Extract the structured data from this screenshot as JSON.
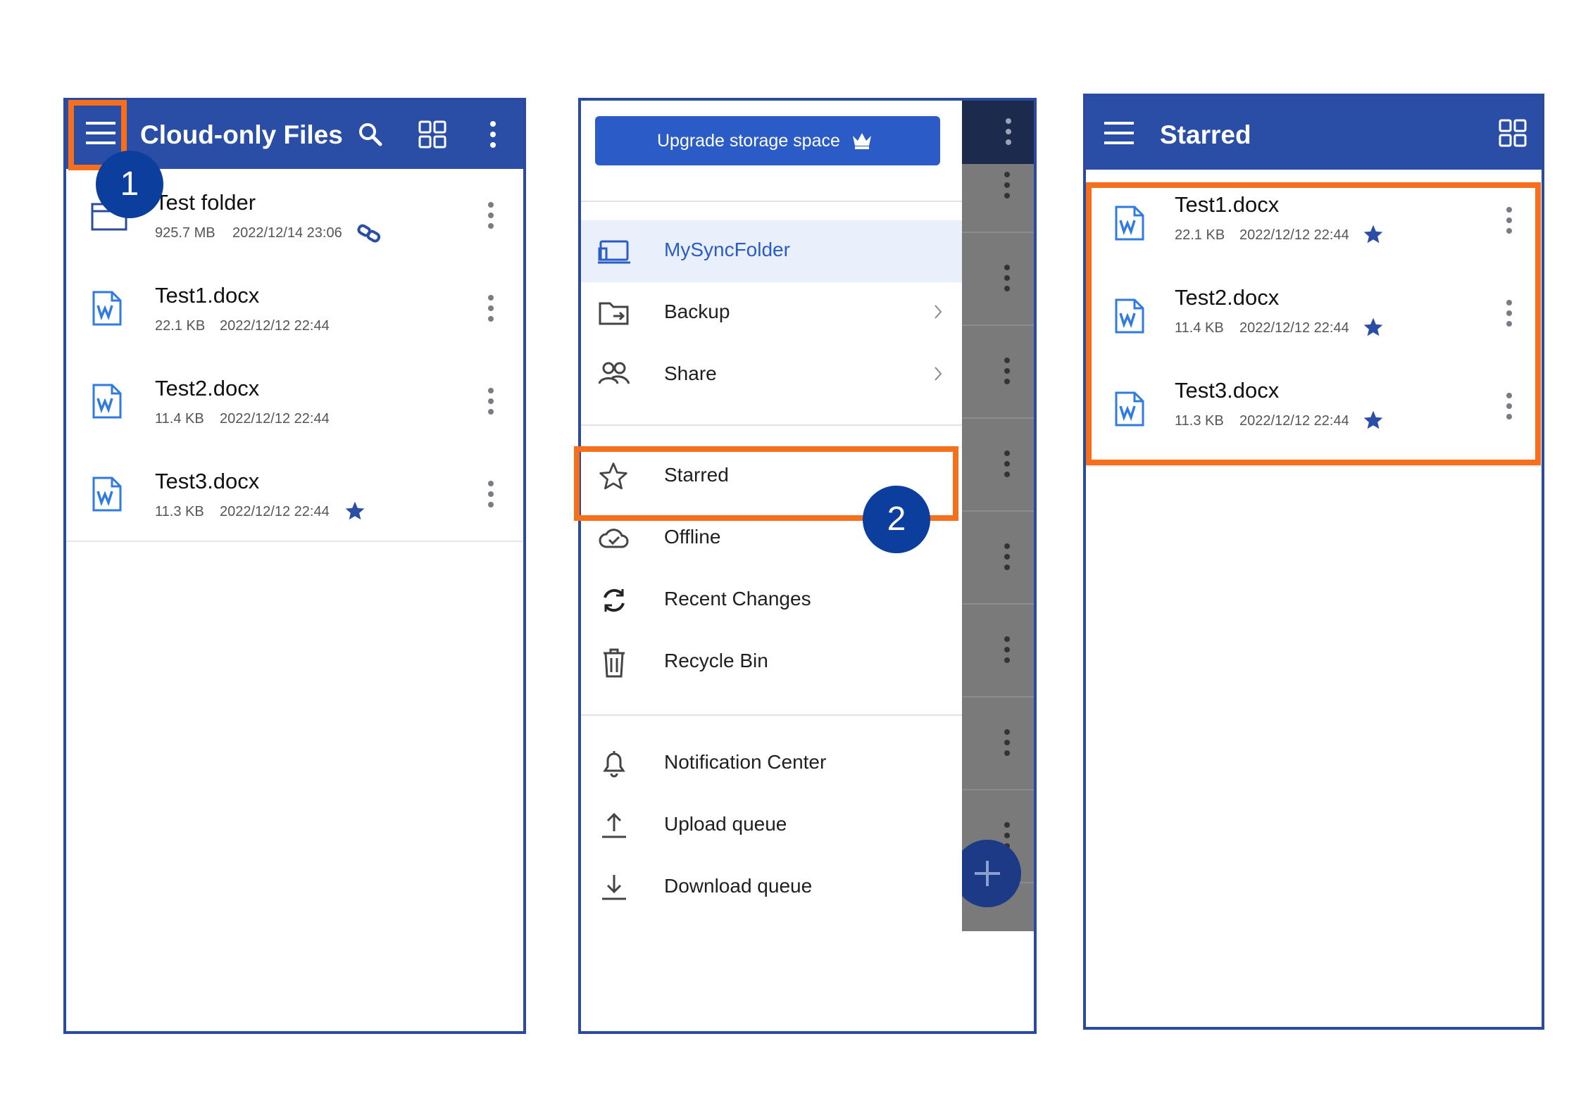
{
  "step_badges": [
    "1",
    "2"
  ],
  "panel1": {
    "title": "Cloud-only Files",
    "icons": [
      "menu-icon",
      "search-icon",
      "grid-view-icon",
      "more-vert-icon"
    ],
    "files": [
      {
        "name": "Test folder",
        "size": "925.7 MB",
        "date": "2022/12/14 23:06",
        "type": "folder",
        "linked": true,
        "starred": false
      },
      {
        "name": "Test1.docx",
        "size": "22.1 KB",
        "date": "2022/12/12 22:44",
        "type": "docx",
        "starred": false
      },
      {
        "name": "Test2.docx",
        "size": "11.4 KB",
        "date": "2022/12/12 22:44",
        "type": "docx",
        "starred": false
      },
      {
        "name": "Test3.docx",
        "size": "11.3 KB",
        "date": "2022/12/12 22:44",
        "type": "docx",
        "starred": true
      }
    ]
  },
  "panel2": {
    "upgrade_label": "Upgrade storage space",
    "menu": [
      {
        "label": "MySyncFolder",
        "icon": "sync-folder-icon",
        "active": true
      },
      {
        "label": "Backup",
        "icon": "backup-folder-icon",
        "chevron": true
      },
      {
        "label": "Share",
        "icon": "people-icon",
        "chevron": true
      },
      {
        "label": "Starred",
        "icon": "star-outline-icon"
      },
      {
        "label": "Offline",
        "icon": "cloud-check-icon"
      },
      {
        "label": "Recent Changes",
        "icon": "refresh-icon"
      },
      {
        "label": "Recycle Bin",
        "icon": "trash-icon"
      },
      {
        "label": "Notification Center",
        "icon": "bell-icon"
      },
      {
        "label": "Upload queue",
        "icon": "upload-icon"
      },
      {
        "label": "Download queue",
        "icon": "download-icon"
      }
    ]
  },
  "panel3": {
    "title": "Starred",
    "icons": [
      "menu-icon",
      "grid-view-icon"
    ],
    "files": [
      {
        "name": "Test1.docx",
        "size": "22.1 KB",
        "date": "2022/12/12 22:44",
        "starred": true
      },
      {
        "name": "Test2.docx",
        "size": "11.4 KB",
        "date": "2022/12/12 22:44",
        "starred": true
      },
      {
        "name": "Test3.docx",
        "size": "11.3 KB",
        "date": "2022/12/12 22:44",
        "starred": true
      }
    ]
  },
  "colors": {
    "appbar": "#2a4ea6",
    "highlight": "#f56f1d",
    "badge": "#0c3e9e",
    "accent": "#2a5bc6",
    "frame": "#2a4aa0"
  }
}
